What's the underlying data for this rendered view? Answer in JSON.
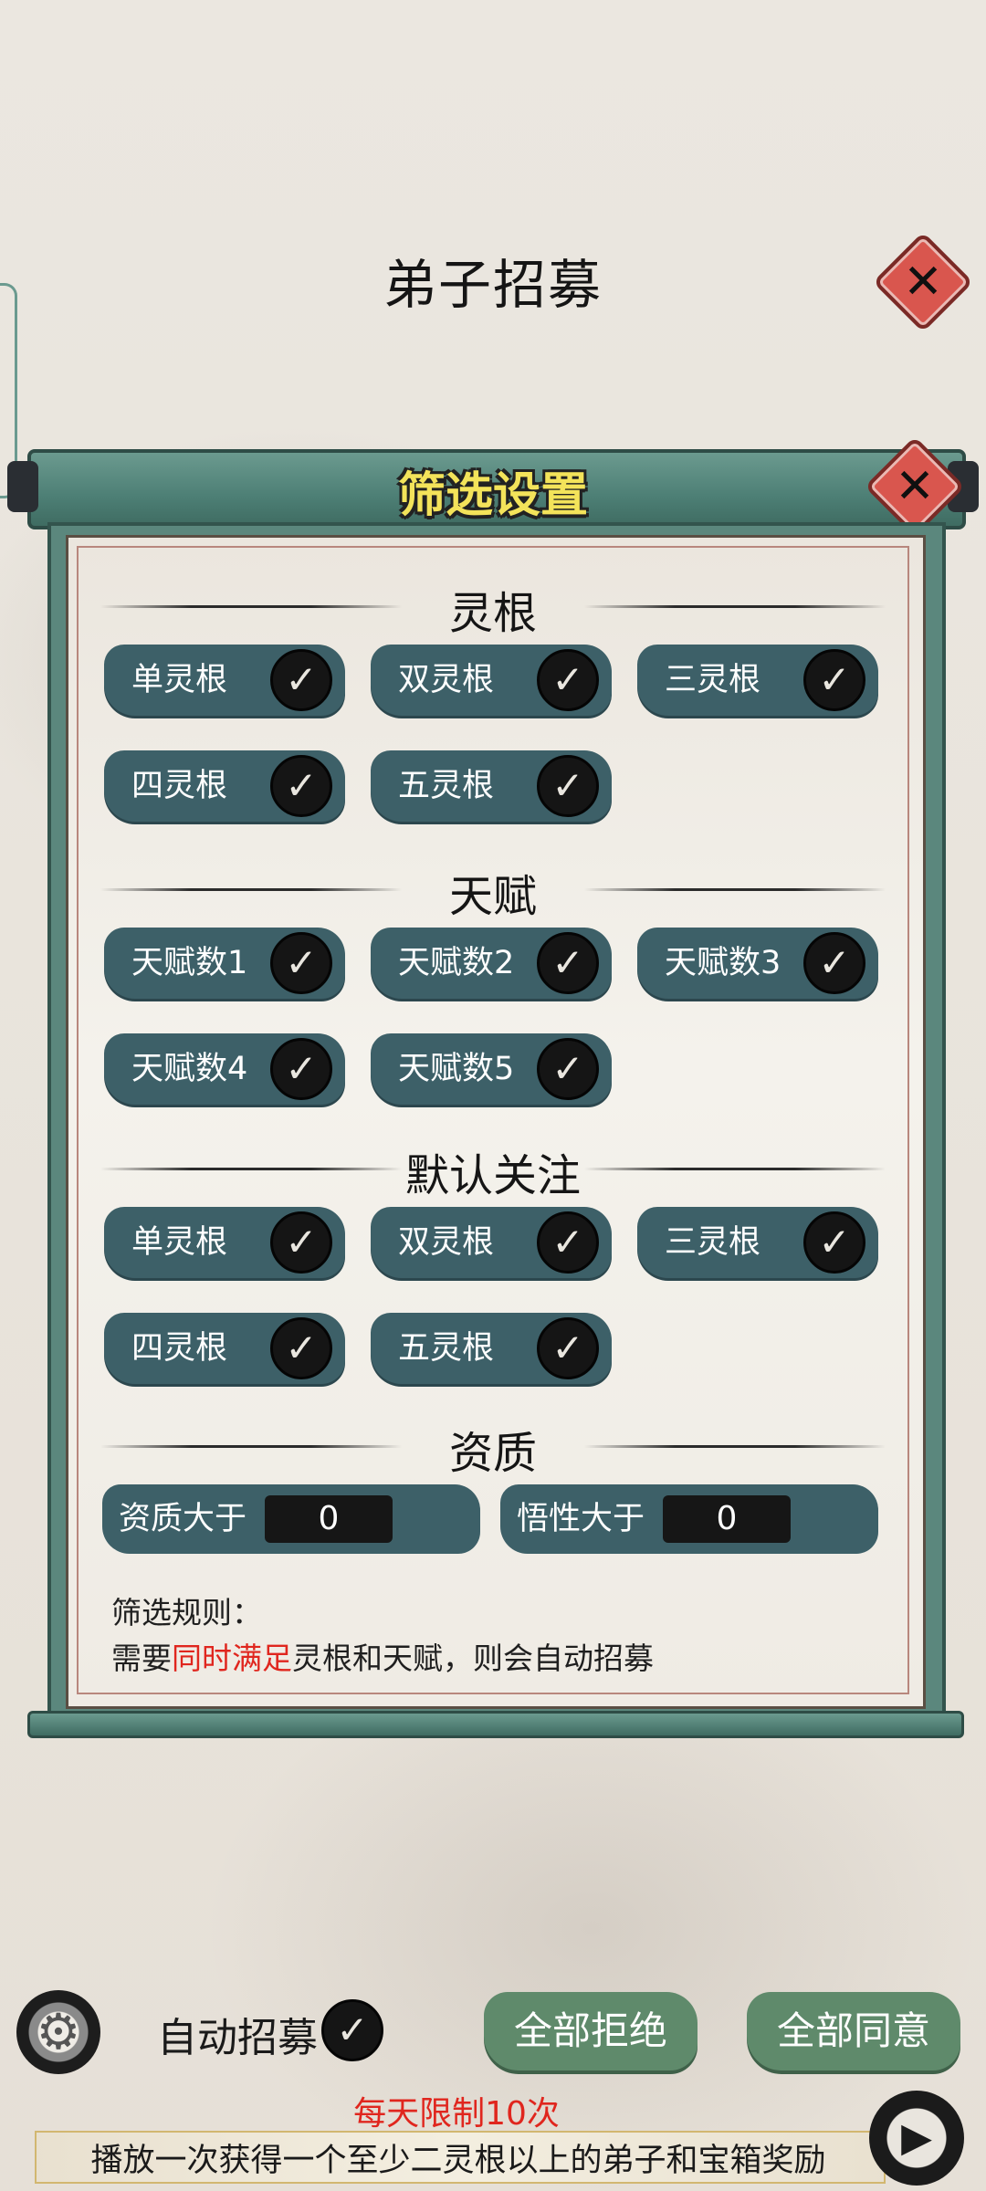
{
  "header": {
    "title": "弟子招募",
    "close_icon": "✕"
  },
  "panel": {
    "title": "筛选设置",
    "close_icon": "✕"
  },
  "check_mark": "✓",
  "sections": {
    "linggen": {
      "title": "灵根",
      "options": [
        "单灵根",
        "双灵根",
        "三灵根",
        "四灵根",
        "五灵根"
      ]
    },
    "tianfu": {
      "title": "天赋",
      "options": [
        "天赋数1",
        "天赋数2",
        "天赋数3",
        "天赋数4",
        "天赋数5"
      ]
    },
    "moren": {
      "title": "默认关注",
      "options": [
        "单灵根",
        "双灵根",
        "三灵根",
        "四灵根",
        "五灵根"
      ]
    },
    "zizhi": {
      "title": "资质",
      "aptitude_label": "资质大于",
      "aptitude_value": "0",
      "comprehension_label": "悟性大于",
      "comprehension_value": "0"
    }
  },
  "rules": {
    "title": "筛选规则：",
    "prefix": "需要",
    "highlight": "同时满足",
    "suffix": "灵根和天赋，则会自动招募"
  },
  "bottom": {
    "settings_icon": "⚙",
    "auto_label": "自动招募",
    "reject_all": "全部拒绝",
    "accept_all": "全部同意",
    "daily_limit": "每天限制10次",
    "ad_text": "播放一次获得一个至少二灵根以上的弟子和宝箱奖励",
    "play_icon": "▶"
  },
  "colors": {
    "chip": "#3d6068",
    "frame": "#5b877d",
    "button": "#5f8a6b",
    "title_yellow": "#f3e35a",
    "highlight_red": "#e0261e",
    "close_red": "#d9564e"
  }
}
